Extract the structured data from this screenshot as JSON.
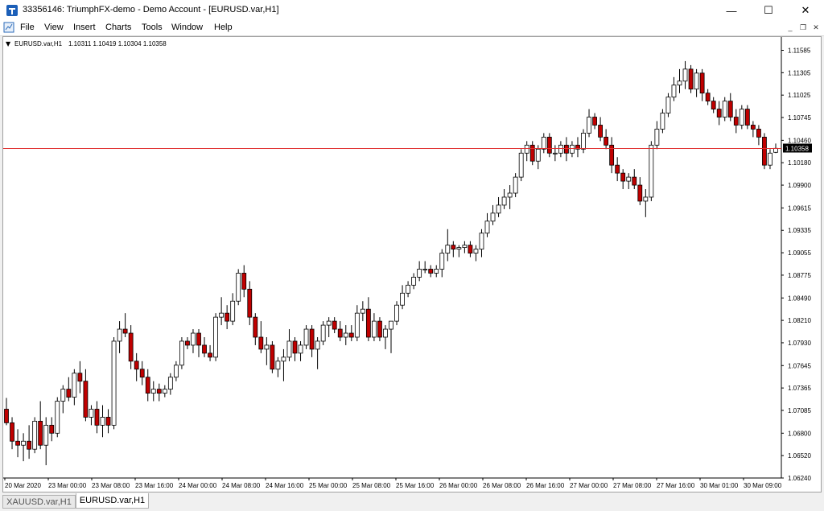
{
  "window": {
    "title": "33356146: TriumphFX-demo - Demo Account - [EURUSD.var,H1]",
    "minimize_glyph": "—",
    "maximize_glyph": "☐",
    "close_glyph": "✕"
  },
  "menu": {
    "items": [
      "File",
      "View",
      "Insert",
      "Charts",
      "Tools",
      "Window",
      "Help"
    ],
    "mdi_minimize": "_",
    "mdi_restore": "❐",
    "mdi_close": "✕"
  },
  "chart_header": {
    "symbol_text": "EURUSD.var,H1",
    "ohlc_text": "1.10311 1.10419 1.10304 1.10358"
  },
  "tabs": [
    {
      "label": "XAUUSD.var,H1",
      "active": false
    },
    {
      "label": "EURUSD.var,H1",
      "active": true
    }
  ],
  "colors": {
    "bear": "#c00000",
    "bull": "#ffffff",
    "wick": "#000000",
    "price_line": "#e03030",
    "price_label_bg": "#000000"
  },
  "chart_data": {
    "type": "candlestick",
    "symbol": "EURUSD.var",
    "timeframe": "H1",
    "ylim": [
      1.0624,
      1.1159
    ],
    "y_ticks": [
      "1.11585",
      "1.11305",
      "1.11025",
      "1.10745",
      "1.10460",
      "1.10180",
      "1.09900",
      "1.09615",
      "1.09335",
      "1.09055",
      "1.08775",
      "1.08490",
      "1.08210",
      "1.07930",
      "1.07645",
      "1.07365",
      "1.07085",
      "1.06800",
      "1.06520",
      "1.06240"
    ],
    "x_ticks": [
      "20 Mar 2020",
      "23 Mar 00:00",
      "23 Mar 08:00",
      "23 Mar 16:00",
      "24 Mar 00:00",
      "24 Mar 08:00",
      "24 Mar 16:00",
      "25 Mar 00:00",
      "25 Mar 08:00",
      "25 Mar 16:00",
      "26 Mar 00:00",
      "26 Mar 08:00",
      "26 Mar 16:00",
      "27 Mar 00:00",
      "27 Mar 08:00",
      "27 Mar 16:00",
      "30 Mar 01:00",
      "30 Mar 09:00"
    ],
    "current_price": "1.10358",
    "candles": [
      [
        1.071,
        1.0724,
        1.069,
        1.0693
      ],
      [
        1.0693,
        1.07,
        1.066,
        1.067
      ],
      [
        1.067,
        1.0685,
        1.065,
        1.0665
      ],
      [
        1.0665,
        1.068,
        1.0645,
        1.067
      ],
      [
        1.067,
        1.069,
        1.0648,
        1.066
      ],
      [
        1.066,
        1.07,
        1.0655,
        1.0695
      ],
      [
        1.0695,
        1.072,
        1.066,
        1.0665
      ],
      [
        1.0665,
        1.07,
        1.064,
        1.069
      ],
      [
        1.069,
        1.07,
        1.067,
        1.068
      ],
      [
        1.068,
        1.0725,
        1.0675,
        1.072
      ],
      [
        1.072,
        1.074,
        1.0705,
        1.0735
      ],
      [
        1.0735,
        1.075,
        1.072,
        1.0725
      ],
      [
        1.0725,
        1.076,
        1.0715,
        1.0755
      ],
      [
        1.0755,
        1.077,
        1.073,
        1.0745
      ],
      [
        1.0745,
        1.076,
        1.0695,
        1.07
      ],
      [
        1.07,
        1.0715,
        1.069,
        1.071
      ],
      [
        1.071,
        1.072,
        1.068,
        1.069
      ],
      [
        1.069,
        1.0715,
        1.0675,
        1.07
      ],
      [
        1.07,
        1.071,
        1.068,
        1.069
      ],
      [
        1.069,
        1.08,
        1.0685,
        1.0795
      ],
      [
        1.0795,
        1.082,
        1.078,
        1.081
      ],
      [
        1.081,
        1.083,
        1.08,
        1.0805
      ],
      [
        1.0805,
        1.0815,
        1.076,
        1.077
      ],
      [
        1.077,
        1.078,
        1.0745,
        1.076
      ],
      [
        1.076,
        1.077,
        1.074,
        1.075
      ],
      [
        1.075,
        1.076,
        1.072,
        1.073
      ],
      [
        1.073,
        1.0745,
        1.072,
        1.0735
      ],
      [
        1.0735,
        1.0742,
        1.072,
        1.073
      ],
      [
        1.073,
        1.074,
        1.0725,
        1.0735
      ],
      [
        1.0735,
        1.0755,
        1.0728,
        1.075
      ],
      [
        1.075,
        1.077,
        1.0745,
        1.0765
      ],
      [
        1.0765,
        1.08,
        1.076,
        1.0795
      ],
      [
        1.0795,
        1.08,
        1.0785,
        1.079
      ],
      [
        1.079,
        1.081,
        1.078,
        1.0805
      ],
      [
        1.0805,
        1.081,
        1.0775,
        1.079
      ],
      [
        1.079,
        1.08,
        1.0775,
        1.078
      ],
      [
        1.078,
        1.079,
        1.077,
        1.0775
      ],
      [
        1.0775,
        1.083,
        1.077,
        1.0825
      ],
      [
        1.0825,
        1.085,
        1.0815,
        1.083
      ],
      [
        1.083,
        1.084,
        1.081,
        1.082
      ],
      [
        1.082,
        1.0855,
        1.0815,
        1.0845
      ],
      [
        1.0845,
        1.0885,
        1.084,
        1.088
      ],
      [
        1.088,
        1.089,
        1.085,
        1.086
      ],
      [
        1.086,
        1.087,
        1.0815,
        1.0825
      ],
      [
        1.0825,
        1.083,
        1.079,
        1.08
      ],
      [
        1.08,
        1.082,
        1.078,
        1.0785
      ],
      [
        1.0785,
        1.08,
        1.0765,
        1.079
      ],
      [
        1.079,
        1.0795,
        1.0755,
        1.076
      ],
      [
        1.076,
        1.0775,
        1.075,
        1.077
      ],
      [
        1.077,
        1.0785,
        1.0745,
        1.0775
      ],
      [
        1.0775,
        1.081,
        1.077,
        1.0795
      ],
      [
        1.0795,
        1.08,
        1.077,
        1.078
      ],
      [
        1.078,
        1.0795,
        1.077,
        1.079
      ],
      [
        1.079,
        1.0815,
        1.0785,
        1.081
      ],
      [
        1.081,
        1.0815,
        1.0775,
        1.0785
      ],
      [
        1.0785,
        1.08,
        1.076,
        1.0795
      ],
      [
        1.0795,
        1.082,
        1.079,
        1.0815
      ],
      [
        1.0815,
        1.0825,
        1.08,
        1.082
      ],
      [
        1.082,
        1.0825,
        1.0805,
        1.081
      ],
      [
        1.081,
        1.082,
        1.0795,
        1.08
      ],
      [
        1.08,
        1.0815,
        1.079,
        1.0805
      ],
      [
        1.0805,
        1.0815,
        1.0795,
        1.08
      ],
      [
        1.08,
        1.084,
        1.0795,
        1.083
      ],
      [
        1.083,
        1.0845,
        1.082,
        1.0835
      ],
      [
        1.0835,
        1.085,
        1.0795,
        1.08
      ],
      [
        1.08,
        1.083,
        1.0795,
        1.082
      ],
      [
        1.082,
        1.0825,
        1.0795,
        1.08
      ],
      [
        1.08,
        1.0815,
        1.0785,
        1.081
      ],
      [
        1.081,
        1.082,
        1.078,
        1.082
      ],
      [
        1.082,
        1.0845,
        1.0815,
        1.084
      ],
      [
        1.084,
        1.0865,
        1.0835,
        1.0855
      ],
      [
        1.0855,
        1.087,
        1.085,
        1.0865
      ],
      [
        1.0865,
        1.088,
        1.086,
        1.0875
      ],
      [
        1.0875,
        1.0895,
        1.087,
        1.0885
      ],
      [
        1.0885,
        1.0895,
        1.088,
        1.0885
      ],
      [
        1.0885,
        1.089,
        1.0875,
        1.088
      ],
      [
        1.088,
        1.089,
        1.0875,
        1.0885
      ],
      [
        1.0885,
        1.091,
        1.0875,
        1.0905
      ],
      [
        1.0905,
        1.0935,
        1.0895,
        1.0915
      ],
      [
        1.0915,
        1.092,
        1.09,
        1.091
      ],
      [
        1.091,
        1.0915,
        1.09,
        1.0912
      ],
      [
        1.0912,
        1.092,
        1.0905,
        1.0915
      ],
      [
        1.0915,
        1.092,
        1.09,
        1.0905
      ],
      [
        1.0905,
        1.0915,
        1.0895,
        1.091
      ],
      [
        1.091,
        1.0935,
        1.09,
        1.093
      ],
      [
        1.093,
        1.0955,
        1.0925,
        1.0945
      ],
      [
        1.0945,
        1.0965,
        1.094,
        1.0955
      ],
      [
        1.0955,
        1.0975,
        1.095,
        1.0965
      ],
      [
        1.0965,
        1.0985,
        1.096,
        1.0975
      ],
      [
        1.0975,
        1.099,
        1.096,
        1.098
      ],
      [
        1.098,
        1.1005,
        1.0975,
        1.1
      ],
      [
        1.1,
        1.1035,
        1.0995,
        1.103
      ],
      [
        1.103,
        1.1045,
        1.102,
        1.104
      ],
      [
        1.104,
        1.1045,
        1.1015,
        1.102
      ],
      [
        1.102,
        1.104,
        1.101,
        1.1035
      ],
      [
        1.1035,
        1.1055,
        1.103,
        1.105
      ],
      [
        1.105,
        1.1055,
        1.1025,
        1.103
      ],
      [
        1.103,
        1.104,
        1.102,
        1.103
      ],
      [
        1.103,
        1.1045,
        1.1025,
        1.104
      ],
      [
        1.104,
        1.105,
        1.102,
        1.103
      ],
      [
        1.103,
        1.1045,
        1.1025,
        1.104
      ],
      [
        1.104,
        1.105,
        1.1025,
        1.1035
      ],
      [
        1.1035,
        1.106,
        1.103,
        1.1055
      ],
      [
        1.1055,
        1.1085,
        1.105,
        1.1075
      ],
      [
        1.1075,
        1.108,
        1.106,
        1.1065
      ],
      [
        1.1065,
        1.1075,
        1.1045,
        1.105
      ],
      [
        1.105,
        1.106,
        1.1035,
        1.104
      ],
      [
        1.104,
        1.105,
        1.1005,
        1.1015
      ],
      [
        1.1015,
        1.1025,
        1.0995,
        1.1005
      ],
      [
        1.1005,
        1.101,
        1.0985,
        1.0995
      ],
      [
        1.0995,
        1.1005,
        1.0985,
        1.1
      ],
      [
        1.1,
        1.101,
        1.0985,
        1.099
      ],
      [
        1.099,
        1.1,
        1.0965,
        1.097
      ],
      [
        1.097,
        1.0985,
        1.095,
        1.0975
      ],
      [
        1.0975,
        1.1045,
        1.097,
        1.104
      ],
      [
        1.104,
        1.107,
        1.1035,
        1.106
      ],
      [
        1.106,
        1.1085,
        1.1055,
        1.108
      ],
      [
        1.108,
        1.1105,
        1.1075,
        1.11
      ],
      [
        1.11,
        1.1125,
        1.1095,
        1.1115
      ],
      [
        1.1115,
        1.1135,
        1.1105,
        1.112
      ],
      [
        1.112,
        1.1145,
        1.111,
        1.1135
      ],
      [
        1.1135,
        1.114,
        1.1105,
        1.111
      ],
      [
        1.111,
        1.1135,
        1.11,
        1.113
      ],
      [
        1.113,
        1.1135,
        1.1095,
        1.1105
      ],
      [
        1.1105,
        1.111,
        1.109,
        1.1095
      ],
      [
        1.1095,
        1.11,
        1.108,
        1.1085
      ],
      [
        1.1085,
        1.1095,
        1.1065,
        1.1075
      ],
      [
        1.1075,
        1.11,
        1.107,
        1.1095
      ],
      [
        1.1095,
        1.1105,
        1.107,
        1.1075
      ],
      [
        1.1075,
        1.1085,
        1.1055,
        1.1065
      ],
      [
        1.1065,
        1.109,
        1.106,
        1.1085
      ],
      [
        1.1085,
        1.109,
        1.106,
        1.1065
      ],
      [
        1.1065,
        1.107,
        1.105,
        1.106
      ],
      [
        1.106,
        1.1065,
        1.104,
        1.105
      ],
      [
        1.105,
        1.1055,
        1.101,
        1.1015
      ],
      [
        1.1015,
        1.1035,
        1.101,
        1.103
      ],
      [
        1.1031,
        1.1042,
        1.103,
        1.1036
      ]
    ]
  }
}
